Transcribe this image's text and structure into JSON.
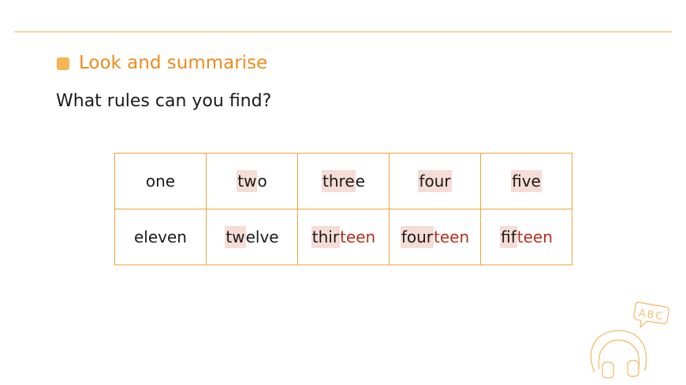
{
  "section": {
    "title": "Look and summarise"
  },
  "question": "What rules can you find?",
  "table": {
    "rows": [
      [
        {
          "parts": [
            {
              "text": "one",
              "style": "plain"
            }
          ]
        },
        {
          "parts": [
            {
              "text": "tw",
              "style": "hl"
            },
            {
              "text": "o",
              "style": "plain"
            }
          ]
        },
        {
          "parts": [
            {
              "text": "thre",
              "style": "hl"
            },
            {
              "text": "e",
              "style": "plain"
            }
          ]
        },
        {
          "parts": [
            {
              "text": "four",
              "style": "hl"
            }
          ]
        },
        {
          "parts": [
            {
              "text": "five",
              "style": "hl"
            }
          ]
        }
      ],
      [
        {
          "parts": [
            {
              "text": "eleven",
              "style": "plain"
            }
          ]
        },
        {
          "parts": [
            {
              "text": "tw",
              "style": "hl"
            },
            {
              "text": "elve",
              "style": "plain"
            }
          ]
        },
        {
          "parts": [
            {
              "text": "thir",
              "style": "hl"
            },
            {
              "text": "teen",
              "style": "red"
            }
          ]
        },
        {
          "parts": [
            {
              "text": "four",
              "style": "hl"
            },
            {
              "text": "teen",
              "style": "red"
            }
          ]
        },
        {
          "parts": [
            {
              "text": "fif",
              "style": "hl"
            },
            {
              "text": "teen",
              "style": "red"
            }
          ]
        }
      ]
    ]
  },
  "decoration": {
    "bubble_text": "ABC",
    "icon": "headphones-icon",
    "color": "#f2c27a"
  },
  "colors": {
    "accent": "#ef8a1c",
    "rule": "#f0b455",
    "bullet": "#f5b553",
    "table_border": "#f0a43e",
    "highlight": "#f6dcd6",
    "suffix_red": "#b5301f"
  }
}
